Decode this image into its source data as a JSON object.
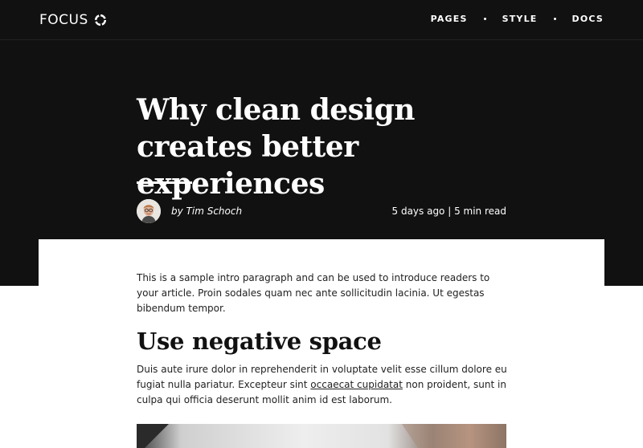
{
  "header": {
    "logo_text": "FOCUS",
    "logo_icon": "circle-notch-icon",
    "nav": [
      {
        "label": "PAGES"
      },
      {
        "label": "STYLE"
      },
      {
        "label": "DOCS"
      }
    ]
  },
  "hero": {
    "title": "Why clean design creates better experiences",
    "author": "by Tim Schoch",
    "meta": "5 days ago | 5 min read"
  },
  "article": {
    "intro": "This is a sample intro paragraph and can be used to introduce readers to your article. Proin sodales quam nec ante sollicitudin lacinia. Ut egestas bibendum tempor.",
    "section_heading": "Use negative space",
    "body_before_link": "Duis aute irure dolor in reprehenderit in voluptate velit esse cillum dolore eu fugiat nulla pariatur. Excepteur sint ",
    "body_link": "occaecat cupidatat",
    "body_after_link": " non proident, sunt in culpa qui officia deserunt mollit anim id est laborum."
  },
  "colors": {
    "hero_background": "#111111",
    "page_background": "#ffffff",
    "text": "#222222"
  }
}
